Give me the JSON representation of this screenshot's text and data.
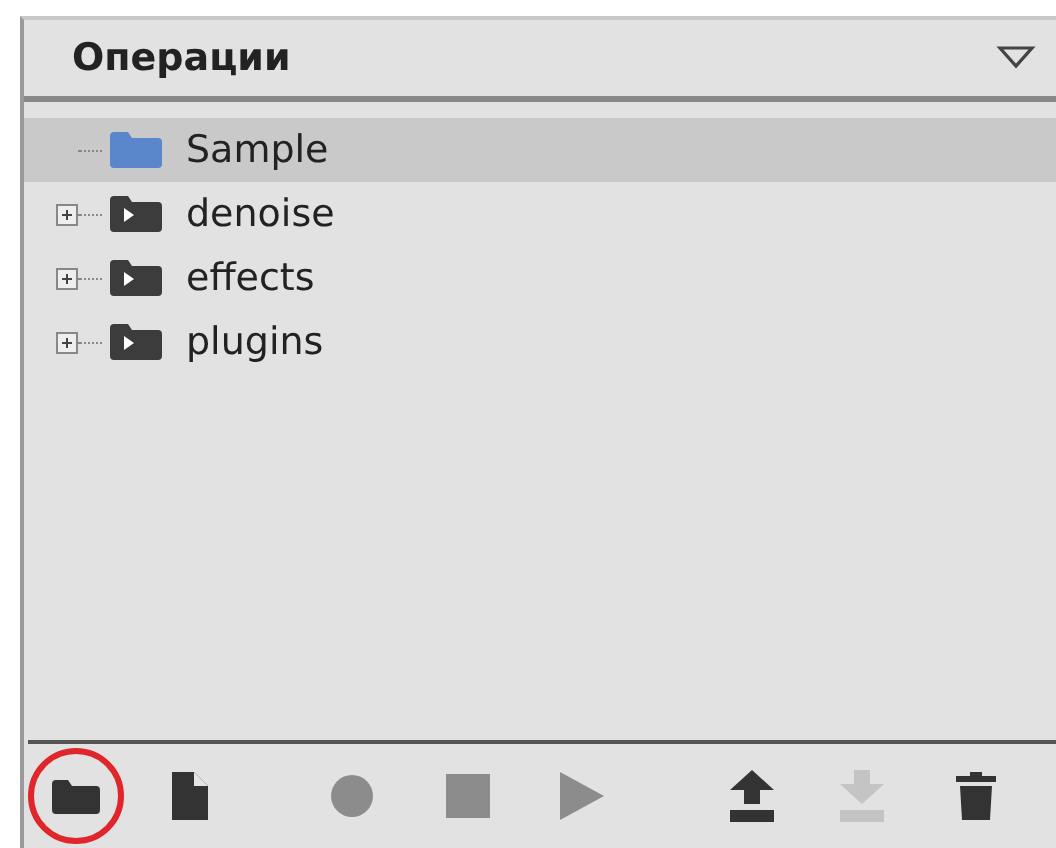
{
  "panel": {
    "title": "Операции"
  },
  "tree": [
    {
      "label": "Sample",
      "kind": "folder",
      "selected": true
    },
    {
      "label": "denoise",
      "kind": "set",
      "selected": false,
      "expanded": false
    },
    {
      "label": "effects",
      "kind": "set",
      "selected": false,
      "expanded": false
    },
    {
      "label": "plugins",
      "kind": "set",
      "selected": false,
      "expanded": false
    }
  ],
  "toolbar": [
    {
      "kind": "folder",
      "disabled": false,
      "highlighted": true
    },
    {
      "kind": "file",
      "disabled": false,
      "highlighted": false
    },
    {
      "kind": "record",
      "disabled": true,
      "highlighted": false
    },
    {
      "kind": "stop",
      "disabled": true,
      "highlighted": false
    },
    {
      "kind": "play",
      "disabled": true,
      "highlighted": false
    },
    {
      "kind": "upload",
      "disabled": false,
      "highlighted": false
    },
    {
      "kind": "download",
      "disabled": true,
      "highlighted": false
    },
    {
      "kind": "trash",
      "disabled": false,
      "highlighted": false
    }
  ]
}
